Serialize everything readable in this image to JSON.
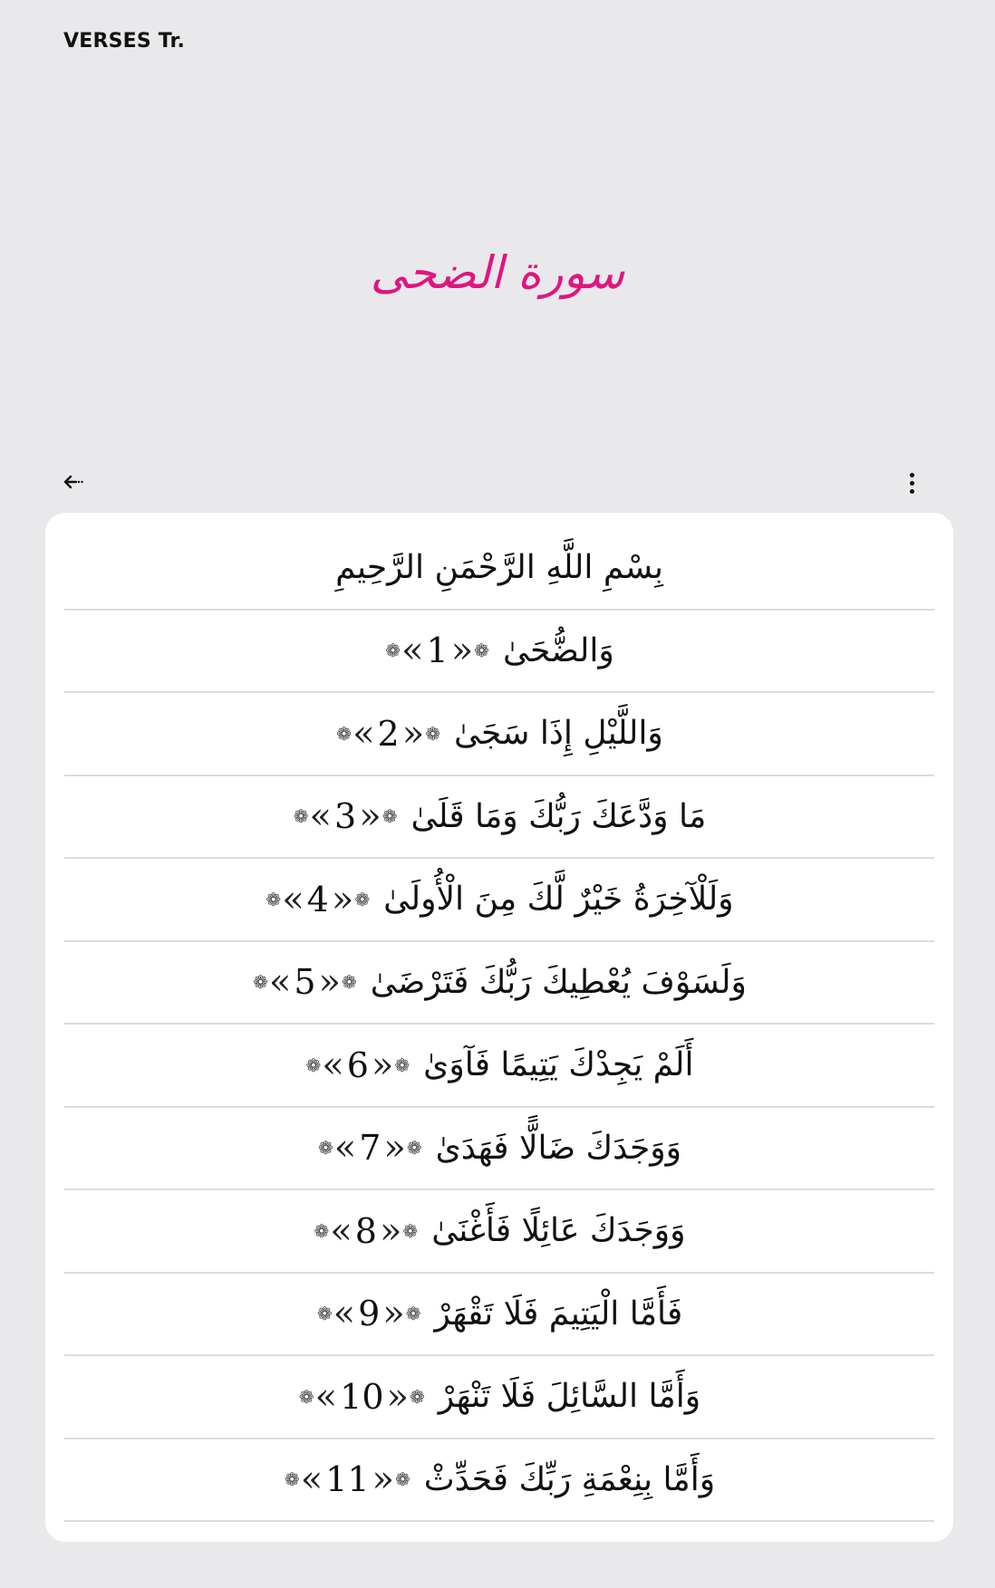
{
  "header": {
    "app_title": "VERSES Tr."
  },
  "surah": {
    "title": "سورة الضحى",
    "title_color": "#e0157f"
  },
  "toolbar": {
    "back_icon": "back-arrow-icon",
    "menu_icon": "more-vert-icon"
  },
  "verses": [
    {
      "text": "بِسْمِ اللَّهِ الرَّحْمَنِ الرَّحِيمِ",
      "number": ""
    },
    {
      "text": "وَالضُّحَىٰ",
      "number": "1"
    },
    {
      "text": "وَاللَّيْلِ إِذَا سَجَىٰ",
      "number": "2"
    },
    {
      "text": "مَا وَدَّعَكَ رَبُّكَ وَمَا قَلَىٰ",
      "number": "3"
    },
    {
      "text": "وَلَلْآخِرَةُ خَيْرٌ لَّكَ مِنَ الْأُولَىٰ",
      "number": "4"
    },
    {
      "text": "وَلَسَوْفَ يُعْطِيكَ رَبُّكَ فَتَرْضَىٰ",
      "number": "5"
    },
    {
      "text": "أَلَمْ يَجِدْكَ يَتِيمًا فَآوَىٰ",
      "number": "6"
    },
    {
      "text": "وَوَجَدَكَ ضَالًّا فَهَدَىٰ",
      "number": "7"
    },
    {
      "text": "وَوَجَدَكَ عَائِلًا فَأَغْنَىٰ",
      "number": "8"
    },
    {
      "text": "فَأَمَّا الْيَتِيمَ فَلَا تَقْهَرْ",
      "number": "9"
    },
    {
      "text": "وَأَمَّا السَّائِلَ فَلَا تَنْهَرْ",
      "number": "10"
    },
    {
      "text": "وَأَمَّا بِنِعْمَةِ رَبِّكَ فَحَدِّثْ",
      "number": "11"
    }
  ]
}
